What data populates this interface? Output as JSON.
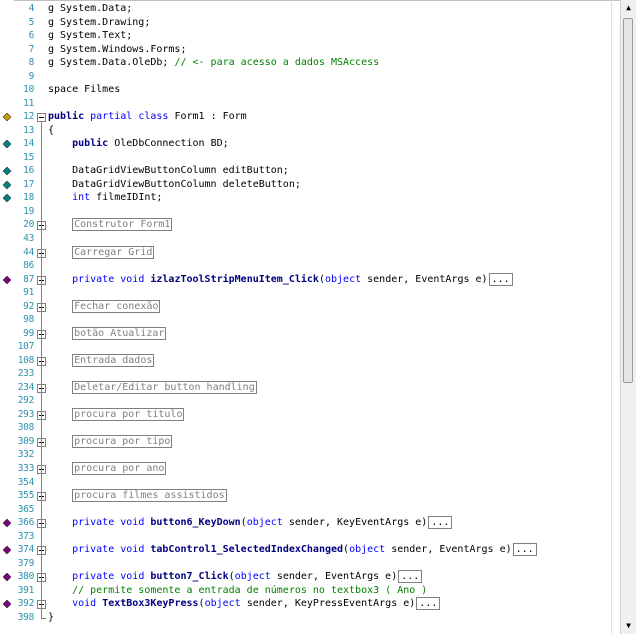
{
  "editor": {
    "lines": [
      {
        "num": "4",
        "segments": [
          {
            "t": "g System.Data;",
            "c": "plain"
          }
        ]
      },
      {
        "num": "5",
        "segments": [
          {
            "t": "g System.Drawing;",
            "c": "plain"
          }
        ]
      },
      {
        "num": "6",
        "segments": [
          {
            "t": "g System.Text;",
            "c": "plain"
          }
        ]
      },
      {
        "num": "7",
        "segments": [
          {
            "t": "g System.Windows.Forms;",
            "c": "plain"
          }
        ]
      },
      {
        "num": "8",
        "segments": [
          {
            "t": "g System.Data.OleDb; ",
            "c": "plain"
          },
          {
            "t": "// <- para acesso a dados MSAccess",
            "c": "cm"
          }
        ]
      },
      {
        "num": "9",
        "segments": []
      },
      {
        "num": "10",
        "segments": [
          {
            "t": "space Filmes",
            "c": "plain"
          }
        ]
      },
      {
        "num": "11",
        "segments": []
      },
      {
        "num": "12",
        "segments": [
          {
            "t": "public",
            "c": "kwb"
          },
          {
            "t": " partial ",
            "c": "kw"
          },
          {
            "t": "class",
            "c": "kw"
          },
          {
            "t": " Form1 : Form",
            "c": "plain"
          }
        ]
      },
      {
        "num": "13",
        "segments": [
          {
            "t": "{",
            "c": "plain"
          }
        ]
      },
      {
        "num": "14",
        "segments": [
          {
            "t": "    public",
            "c": "kwb"
          },
          {
            "t": " OleDbConnection BD;",
            "c": "plain"
          }
        ]
      },
      {
        "num": "15",
        "segments": []
      },
      {
        "num": "16",
        "segments": [
          {
            "t": "    DataGridViewButtonColumn editButton;",
            "c": "plain"
          }
        ]
      },
      {
        "num": "17",
        "segments": [
          {
            "t": "    DataGridViewButtonColumn deleteButton;",
            "c": "plain"
          }
        ]
      },
      {
        "num": "18",
        "segments": [
          {
            "t": "    int",
            "c": "kw"
          },
          {
            "t": " filmeIDInt;",
            "c": "plain"
          }
        ]
      },
      {
        "num": "19",
        "segments": []
      },
      {
        "num": "20",
        "segments": [
          {
            "t": "    ",
            "c": "plain"
          },
          {
            "t": "Construtor Form1",
            "c": "collapsed"
          }
        ]
      },
      {
        "num": "43",
        "segments": []
      },
      {
        "num": "44",
        "segments": [
          {
            "t": "    ",
            "c": "plain"
          },
          {
            "t": "Carregar Grid",
            "c": "collapsed"
          }
        ]
      },
      {
        "num": "86",
        "segments": []
      },
      {
        "num": "87",
        "segments": [
          {
            "t": "    private",
            "c": "kw"
          },
          {
            "t": " void",
            "c": "kw"
          },
          {
            "t": " izlazToolStripMenuItem_Click",
            "c": "fn"
          },
          {
            "t": "(",
            "c": "plain"
          },
          {
            "t": "object",
            "c": "kw"
          },
          {
            "t": " sender, EventArgs e)",
            "c": "plain"
          },
          {
            "t": "...",
            "c": "dots"
          }
        ]
      },
      {
        "num": "91",
        "segments": []
      },
      {
        "num": "92",
        "segments": [
          {
            "t": "    ",
            "c": "plain"
          },
          {
            "t": "Fechar conexão",
            "c": "collapsed"
          }
        ]
      },
      {
        "num": "98",
        "segments": []
      },
      {
        "num": "99",
        "segments": [
          {
            "t": "    ",
            "c": "plain"
          },
          {
            "t": "botão Atualizar",
            "c": "collapsed"
          }
        ]
      },
      {
        "num": "107",
        "segments": []
      },
      {
        "num": "108",
        "segments": [
          {
            "t": "    ",
            "c": "plain"
          },
          {
            "t": "Entrada dados",
            "c": "collapsed"
          }
        ]
      },
      {
        "num": "233",
        "segments": []
      },
      {
        "num": "234",
        "segments": [
          {
            "t": "    ",
            "c": "plain"
          },
          {
            "t": "Deletar/Editar button handling",
            "c": "collapsed"
          }
        ]
      },
      {
        "num": "292",
        "segments": []
      },
      {
        "num": "293",
        "segments": [
          {
            "t": "    ",
            "c": "plain"
          },
          {
            "t": "procura por titulo",
            "c": "collapsed"
          }
        ]
      },
      {
        "num": "308",
        "segments": []
      },
      {
        "num": "309",
        "segments": [
          {
            "t": "    ",
            "c": "plain"
          },
          {
            "t": "procura por tipo",
            "c": "collapsed"
          }
        ]
      },
      {
        "num": "332",
        "segments": []
      },
      {
        "num": "333",
        "segments": [
          {
            "t": "    ",
            "c": "plain"
          },
          {
            "t": "procura por ano",
            "c": "collapsed"
          }
        ]
      },
      {
        "num": "354",
        "segments": []
      },
      {
        "num": "355",
        "segments": [
          {
            "t": "    ",
            "c": "plain"
          },
          {
            "t": "procura filmes assistidos",
            "c": "collapsed"
          }
        ]
      },
      {
        "num": "365",
        "segments": []
      },
      {
        "num": "366",
        "segments": [
          {
            "t": "    private",
            "c": "kw"
          },
          {
            "t": " void",
            "c": "kw"
          },
          {
            "t": " button6_KeyDown",
            "c": "fn"
          },
          {
            "t": "(",
            "c": "plain"
          },
          {
            "t": "object",
            "c": "kw"
          },
          {
            "t": " sender, KeyEventArgs e)",
            "c": "plain"
          },
          {
            "t": "...",
            "c": "dots"
          }
        ]
      },
      {
        "num": "373",
        "segments": []
      },
      {
        "num": "374",
        "segments": [
          {
            "t": "    private",
            "c": "kw"
          },
          {
            "t": " void",
            "c": "kw"
          },
          {
            "t": " tabControl1_SelectedIndexChanged",
            "c": "fn"
          },
          {
            "t": "(",
            "c": "plain"
          },
          {
            "t": "object",
            "c": "kw"
          },
          {
            "t": " sender, EventArgs e)",
            "c": "plain"
          },
          {
            "t": "...",
            "c": "dots"
          }
        ]
      },
      {
        "num": "379",
        "segments": []
      },
      {
        "num": "380",
        "segments": [
          {
            "t": "    private",
            "c": "kw"
          },
          {
            "t": " void",
            "c": "kw"
          },
          {
            "t": " button7_Click",
            "c": "fn"
          },
          {
            "t": "(",
            "c": "plain"
          },
          {
            "t": "object",
            "c": "kw"
          },
          {
            "t": " sender, EventArgs e)",
            "c": "plain"
          },
          {
            "t": "...",
            "c": "dots"
          }
        ]
      },
      {
        "num": "391",
        "segments": [
          {
            "t": "    // permite somente a entrada de números no textbox3 ( Ano )",
            "c": "cm"
          }
        ]
      },
      {
        "num": "392",
        "segments": [
          {
            "t": "    void",
            "c": "kw"
          },
          {
            "t": " TextBox3KeyPress",
            "c": "fn"
          },
          {
            "t": "(",
            "c": "plain"
          },
          {
            "t": "object",
            "c": "kw"
          },
          {
            "t": " sender, KeyPressEventArgs e)",
            "c": "plain"
          },
          {
            "t": "...",
            "c": "dots"
          }
        ]
      },
      {
        "num": "398",
        "segments": [
          {
            "t": "}",
            "c": "plain"
          }
        ]
      }
    ],
    "glyphs": [
      {
        "line": "12",
        "name": "breakpoint-class-icon",
        "color": "#c8a000"
      },
      {
        "line": "14",
        "name": "field-icon",
        "color": "#008080"
      },
      {
        "line": "16",
        "name": "field-icon",
        "color": "#008080"
      },
      {
        "line": "17",
        "name": "field-icon",
        "color": "#008080"
      },
      {
        "line": "18",
        "name": "field-icon",
        "color": "#008080"
      },
      {
        "line": "87",
        "name": "method-icon",
        "color": "#800080"
      },
      {
        "line": "366",
        "name": "method-icon",
        "color": "#800080"
      },
      {
        "line": "374",
        "name": "method-icon",
        "color": "#800080"
      },
      {
        "line": "380",
        "name": "method-icon",
        "color": "#800080"
      },
      {
        "line": "392",
        "name": "method-icon",
        "color": "#800080"
      }
    ],
    "fold_expanded_line": "12",
    "fold_collapsed_lines": [
      "20",
      "44",
      "87",
      "92",
      "99",
      "108",
      "234",
      "293",
      "309",
      "333",
      "355",
      "366",
      "374",
      "380",
      "392"
    ]
  },
  "scrollbar": {
    "up_arrow": "▲",
    "down_arrow": "▼"
  },
  "colors": {
    "keyword": "#0000ff",
    "comment": "#008000",
    "line_number": "#2b91af",
    "collapsed_region": "#808080"
  }
}
